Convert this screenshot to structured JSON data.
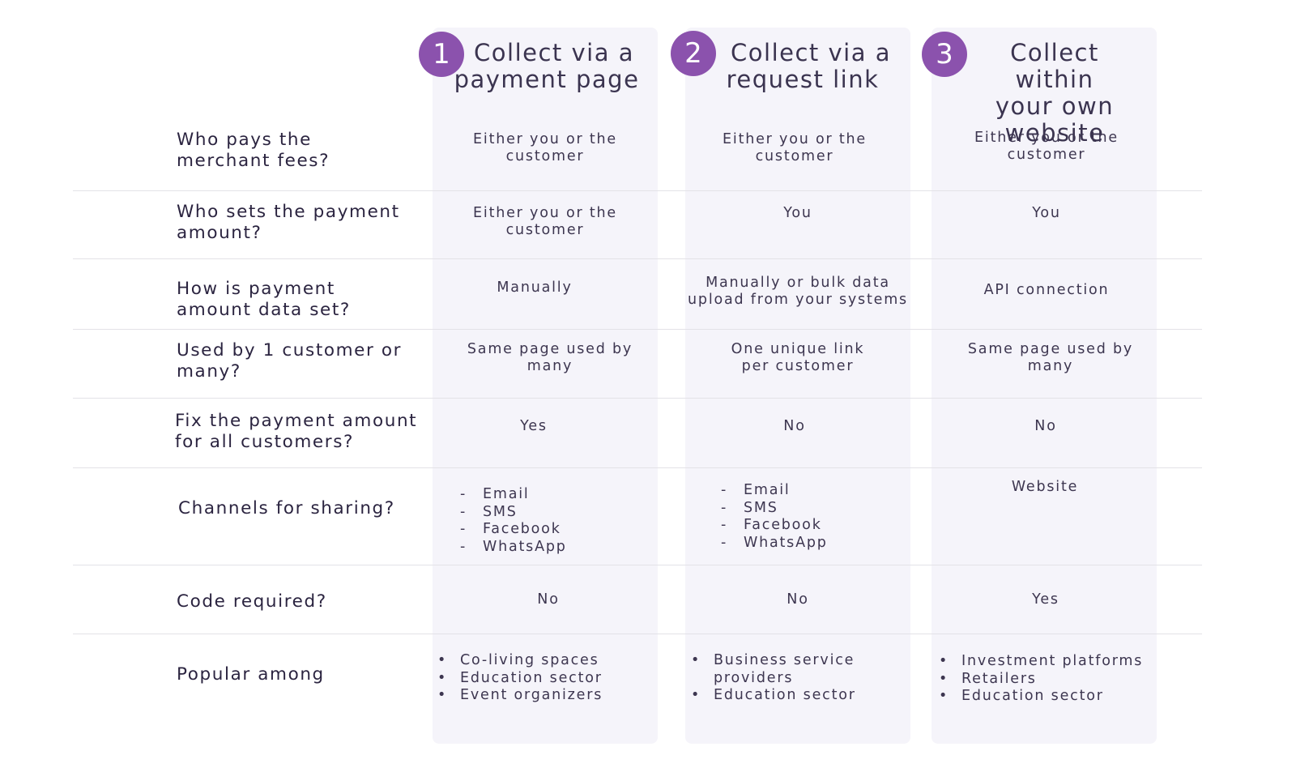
{
  "accent_color": "#8b52ad",
  "columns": [
    {
      "number": "1",
      "title_line1": "Collect via a",
      "title_line2": "payment page"
    },
    {
      "number": "2",
      "title_line1": "Collect via a",
      "title_line2": "request link"
    },
    {
      "number": "3",
      "title_line1": "Collect within",
      "title_line2": "your own",
      "title_line3": "website"
    }
  ],
  "rows": [
    {
      "question_l1": "Who pays the",
      "question_l2": "merchant fees?",
      "cells": [
        [
          "Either you or the",
          "customer"
        ],
        [
          "Either you or the",
          "customer"
        ],
        [
          "Either you or the",
          "customer"
        ]
      ]
    },
    {
      "question_l1": "Who sets the payment",
      "question_l2": "amount?",
      "cells": [
        [
          "Either you or the",
          "customer"
        ],
        [
          "You",
          ""
        ],
        [
          "You",
          ""
        ]
      ]
    },
    {
      "question_l1": "How is payment",
      "question_l2": "amount data set?",
      "cells": [
        [
          "Manually",
          ""
        ],
        [
          "Manually or bulk data",
          "upload from your systems"
        ],
        [
          "API connection",
          ""
        ]
      ]
    },
    {
      "question_l1": "Used by 1 customer or",
      "question_l2": "many?",
      "cells": [
        [
          "Same page used by",
          "many"
        ],
        [
          "One unique link",
          "per customer"
        ],
        [
          "Same page used by",
          "many"
        ]
      ]
    },
    {
      "question_l1": "Fix the payment amount",
      "question_l2": "for all customers?",
      "cells": [
        [
          "Yes",
          ""
        ],
        [
          "No",
          ""
        ],
        [
          "No",
          ""
        ]
      ]
    },
    {
      "question_l1": "Channels for sharing?",
      "question_l2": "",
      "list_marker": "-",
      "cells": [
        [
          "Email",
          "SMS",
          "Facebook",
          "WhatsApp"
        ],
        [
          "Email",
          "SMS",
          "Facebook",
          "WhatsApp"
        ],
        [
          "Website"
        ]
      ]
    },
    {
      "question_l1": "Code required?",
      "question_l2": "",
      "cells": [
        [
          "No",
          ""
        ],
        [
          "No",
          ""
        ],
        [
          "Yes",
          ""
        ]
      ]
    },
    {
      "question_l1": "Popular among",
      "question_l2": "",
      "list_marker": "•",
      "cells": [
        [
          "Co-living spaces",
          "Education sector",
          "Event organizers"
        ],
        [
          "Business service providers",
          "Education sector"
        ],
        [
          "Investment platforms",
          "Retailers",
          "Education sector"
        ]
      ]
    }
  ]
}
